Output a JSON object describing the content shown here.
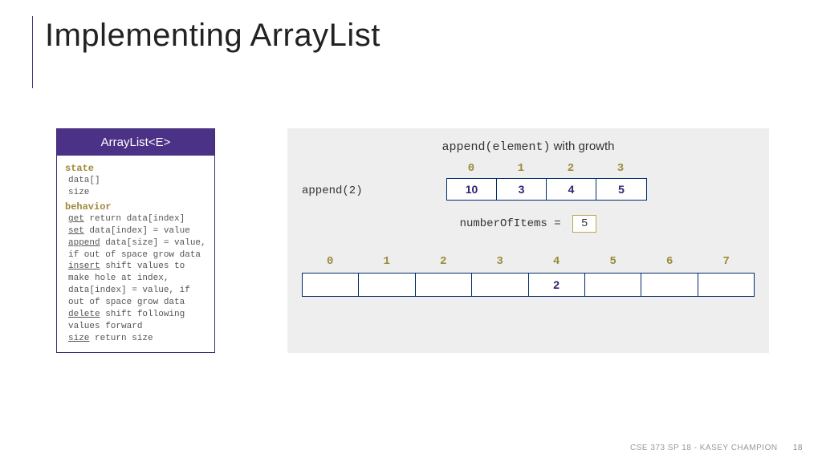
{
  "title": "Implementing ArrayList",
  "class_card": {
    "header": "ArrayList<E>",
    "state_kw": "state",
    "state_lines": "data[]\nsize",
    "behavior_kw": "behavior",
    "get_m": "get",
    "get_txt": " return data[index]",
    "set_m": "set",
    "set_txt": " data[index] = value",
    "append_m": "append",
    "append_txt": " data[size] = value, if out of space grow data",
    "insert_m": "insert",
    "insert_txt": " shift values to make hole at index, data[index] = value, if out of space grow data",
    "delete_m": "delete",
    "delete_txt": " shift following values forward",
    "size_m": "size",
    "size_txt": " return size"
  },
  "diagram": {
    "title_mono": "append(element)",
    "title_sans": " with growth",
    "call": "append(2)",
    "small_indices": [
      "0",
      "1",
      "2",
      "3"
    ],
    "small_values": [
      "10",
      "3",
      "4",
      "5"
    ],
    "nitems_label": "numberOfItems = ",
    "nitems_value": "5",
    "big_indices": [
      "0",
      "1",
      "2",
      "3",
      "4",
      "5",
      "6",
      "7"
    ],
    "big_values": [
      "",
      "",
      "",
      "",
      "2",
      "",
      "",
      ""
    ]
  },
  "footer": {
    "text": "CSE 373 SP 18 - KASEY CHAMPION",
    "page": "18"
  }
}
